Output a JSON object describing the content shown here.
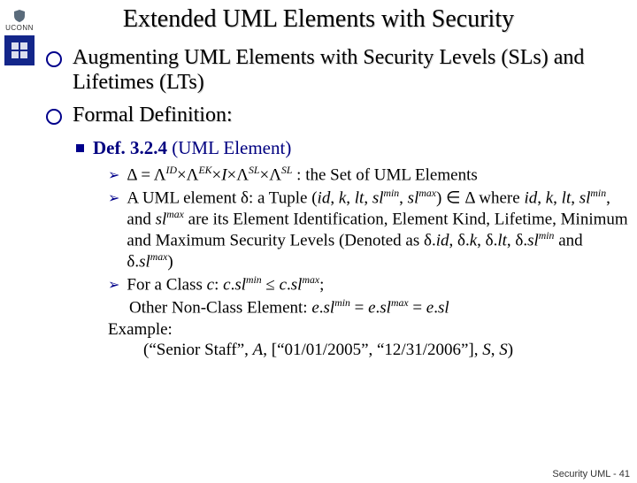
{
  "logo": {
    "uconn": "UCONN"
  },
  "title": "Extended UML Elements with Security",
  "b1": "Augmenting UML Elements with Security Levels (SLs) and Lifetimes (LTs)",
  "b2": "Formal Definition:",
  "def_label": "Def. 3.2.4",
  "def_tail": " (UML Element)",
  "p1_tail": " : the Set of UML Elements",
  "p2a": "A UML element ",
  "p2b": ": a Tuple (",
  "p2c": " where ",
  "p2d": " are its Element Identification, Element Kind, Lifetime, Minimum and Maximum Security Levels (Denoted as ",
  "p3a": "For a Class ",
  "p3b": "Other Non-Class Element: ",
  "ex_label": "Example:",
  "ex_body": "(“Senior Staff”, ",
  "ex_body2": ", [“01/01/2005”, “12/31/2006”], ",
  "footer": "Security UML - 41",
  "sym": {
    "Delta": "Δ",
    "Lambda": "Λ",
    "delta": "δ",
    "times": "×",
    "in": "∈",
    "le": "≤",
    "id": "id",
    "k": "k",
    "lt": "lt",
    "slmin": "sl",
    "slmax": "sl",
    "min": "min",
    "max": "max",
    "ID": "ID",
    "EK": "EK",
    "I": "I",
    "SL": "SL",
    "A": "A",
    "S": "S",
    "c": "c",
    "e": "e",
    "sl": "sl",
    "and": ", and ",
    "comma": ", "
  }
}
